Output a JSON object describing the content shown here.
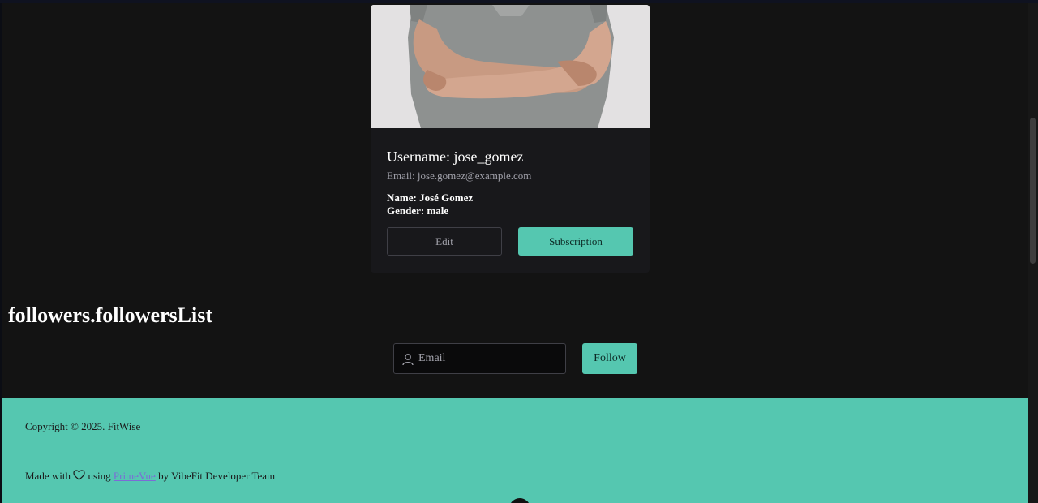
{
  "profile": {
    "username_line": "Username: jose_gomez",
    "email_line": "Email: jose.gomez@example.com",
    "name_line": "Name: José Gomez",
    "gender_line": "Gender: male",
    "edit_label": "Edit",
    "subscription_label": "Subscription"
  },
  "followers": {
    "title": "followers.followersList",
    "email_placeholder": "Email",
    "follow_label": "Follow"
  },
  "footer": {
    "copyright": "Copyright © 2025. FitWise",
    "made_with": "Made with",
    "using": "using",
    "primevue_link": "PrimeVue",
    "by_team": "by VibeFit Developer Team"
  },
  "colors": {
    "accent": "#55c7b0",
    "background": "#131313",
    "card": "#18181b"
  }
}
